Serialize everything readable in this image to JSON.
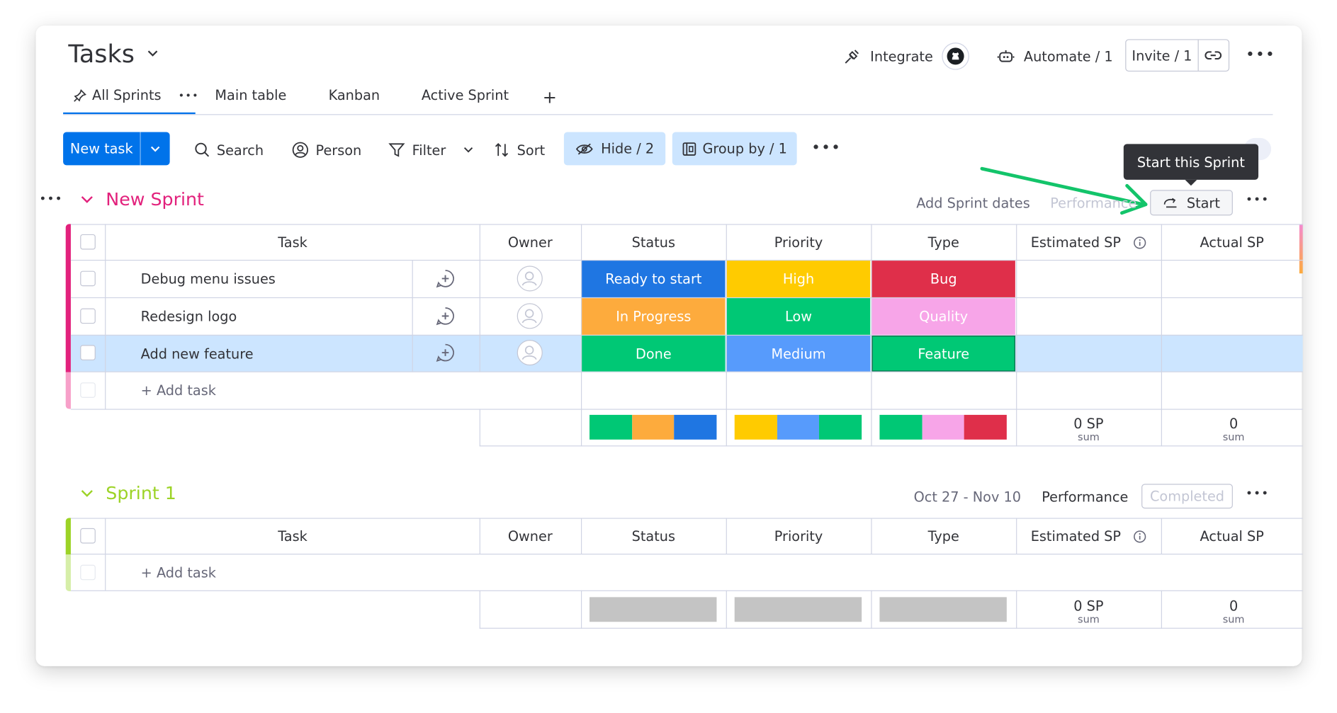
{
  "header": {
    "title": "Tasks",
    "integrate_label": "Integrate",
    "automate_label": "Automate / 1",
    "invite_label": "Invite / 1"
  },
  "tabs": [
    {
      "label": "All Sprints"
    },
    {
      "label": "Main table"
    },
    {
      "label": "Kanban"
    },
    {
      "label": "Active Sprint"
    }
  ],
  "toolbar": {
    "new_task": "New task",
    "search": "Search",
    "person": "Person",
    "filter": "Filter",
    "sort": "Sort",
    "hide": "Hide / 2",
    "group_by": "Group by / 1"
  },
  "tooltip": "Start this Sprint",
  "columns": [
    "Task",
    "Owner",
    "Status",
    "Priority",
    "Type",
    "Estimated SP",
    "Actual SP"
  ],
  "groups": [
    {
      "title": "New Sprint",
      "color": "#e2217c",
      "dates_label": "Add Sprint dates",
      "performance_label": "Performance",
      "action_label": "Start",
      "add_task": "+ Add task",
      "rows": [
        {
          "task": "Debug menu issues",
          "status": "Ready to start",
          "status_color": "#1f76e2",
          "priority": "High",
          "priority_color": "#ffcb00",
          "type": "Bug",
          "type_color": "#df2f4a"
        },
        {
          "task": "Redesign logo",
          "status": "In Progress",
          "status_color": "#fdab3d",
          "priority": "Low",
          "priority_color": "#00c875",
          "type": "Quality",
          "type_color": "#f7a5e8"
        },
        {
          "task": "Add new feature",
          "status": "Done",
          "status_color": "#00c875",
          "priority": "Medium",
          "priority_color": "#579bfc",
          "type": "Feature",
          "type_color": "#00c875"
        }
      ],
      "summary": {
        "status_colors": [
          "#00c875",
          "#fdab3d",
          "#1f76e2"
        ],
        "priority_colors": [
          "#ffcb00",
          "#579bfc",
          "#00c875"
        ],
        "type_colors": [
          "#00c875",
          "#f7a5e8",
          "#df2f4a"
        ],
        "estimated": "0 SP",
        "actual": "0",
        "sum_label": "sum"
      }
    },
    {
      "title": "Sprint 1",
      "color": "#9cd326",
      "dates_label": "Oct 27 - Nov 10",
      "performance_label": "Performance",
      "action_label": "Completed",
      "add_task": "+ Add task",
      "summary": {
        "estimated": "0 SP",
        "actual": "0",
        "sum_label": "sum"
      }
    }
  ]
}
